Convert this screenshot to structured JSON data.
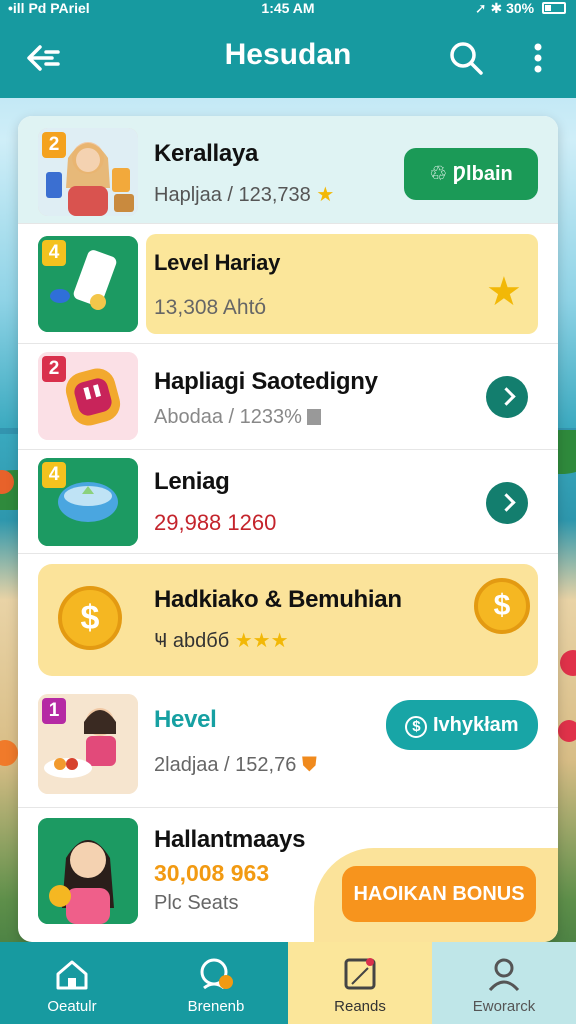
{
  "status_bar": {
    "carrier": "•ill Pd PAriel",
    "time": "1:45 AM",
    "battery": "30%"
  },
  "app_bar": {
    "title": "Hesudan",
    "back_icon": "back-arrow-icon",
    "search_icon": "search-icon",
    "more_icon": "more-vertical-icon"
  },
  "rows": [
    {
      "badge": "2",
      "name": "Kerallaya",
      "sub": "Haplјaa / 123,738",
      "action": "Ƿlbain"
    },
    {
      "badge": "4",
      "name": "Level Hariay",
      "sub": "13,308 Ahtó"
    },
    {
      "badge": "2",
      "name": "Hapliagi Saotedigny",
      "sub": "Abodaa / 1233%"
    },
    {
      "badge": "4",
      "name": "Leniag",
      "sub": "29,988 1260"
    },
    {
      "name": "Hadkiako & Bemuhian",
      "sub": "Ҹ abdбб"
    },
    {
      "badge": "1",
      "name": "Hevel",
      "sub": "2ladjaa / 152,76",
      "action": "Ιvhykłam"
    },
    {
      "name": "Hallantmaays",
      "value": "30,008 963",
      "sub": "Plc Seats",
      "action": "HAOIKAN BONUS"
    }
  ],
  "bottom_nav": [
    {
      "label": "Oeatulr",
      "icon": "home-icon"
    },
    {
      "label": "Brenenb",
      "icon": "rewards-icon"
    },
    {
      "label": "Reands",
      "icon": "tasks-icon"
    },
    {
      "label": "Eworarck",
      "icon": "profile-icon"
    }
  ],
  "colors": {
    "primary": "#179aa0",
    "green_button": "#1b9a57",
    "teal_button": "#18a5a6",
    "highlight_yellow": "#fbe69a",
    "orange_button": "#f7941d"
  }
}
